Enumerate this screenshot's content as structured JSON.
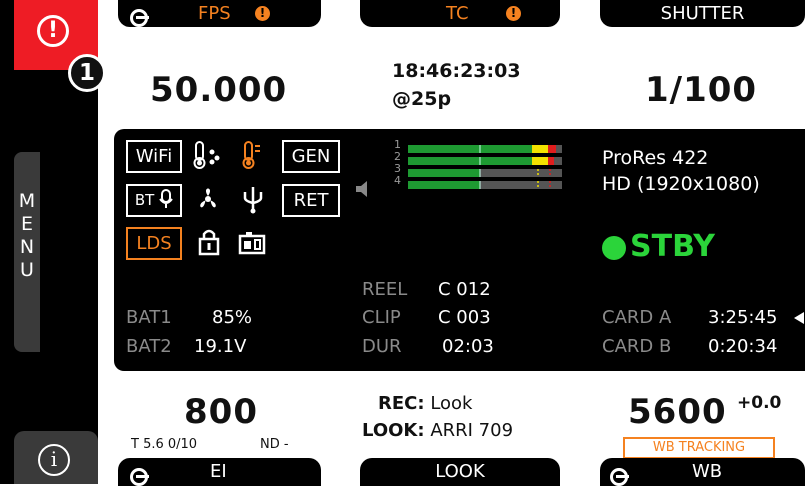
{
  "sidebar": {
    "warning_glyph": "!",
    "warning_count": "1",
    "menu_label": "MENU",
    "info_glyph": "i",
    "warning_color": "#ee1c25"
  },
  "top_tabs": {
    "fps_label": "FPS",
    "tc_label": "TC",
    "shutter_label": "SHUTTER",
    "warn_glyph": "!"
  },
  "values": {
    "fps": "50.000",
    "timecode": "18:46:23:03",
    "tc_rate": "@25p",
    "shutter": "1/100"
  },
  "panel": {
    "icons": {
      "wifi": "WiFi",
      "gen": "GEN",
      "bt": "BT",
      "ret": "RET",
      "lds": "LDS"
    },
    "codec": "ProRes 422",
    "resolution": "HD (1920x1080)",
    "status": "STBY",
    "status_color": "#2bd43a",
    "audio_channels": [
      "1",
      "2",
      "3",
      "4"
    ],
    "bat1_label": "BAT1",
    "bat1_value": "85%",
    "bat2_label": "BAT2",
    "bat2_value": "19.1V",
    "reel_label": "REEL",
    "reel_value": "C 012",
    "clip_label": "CLIP",
    "clip_value": "C 003",
    "dur_label": "DUR",
    "dur_value": "02:03",
    "card_a_label": "CARD A",
    "card_a_value": "3:25:45",
    "card_b_label": "CARD B",
    "card_b_value": "0:20:34"
  },
  "bottom": {
    "ei_value": "800",
    "ei_sub": "T 5.6  0/10",
    "nd_label": "ND -",
    "rec_label": "REC:",
    "rec_value": "Look",
    "look_label": "LOOK:",
    "look_value": "ARRI 709",
    "wb_value": "5600",
    "wb_tint": "+0.0",
    "wb_tracking": "WB TRACKING"
  },
  "bottom_tabs": {
    "ei_label": "EI",
    "look_label": "LOOK",
    "wb_label": "WB"
  },
  "accent_color": "#f58220"
}
